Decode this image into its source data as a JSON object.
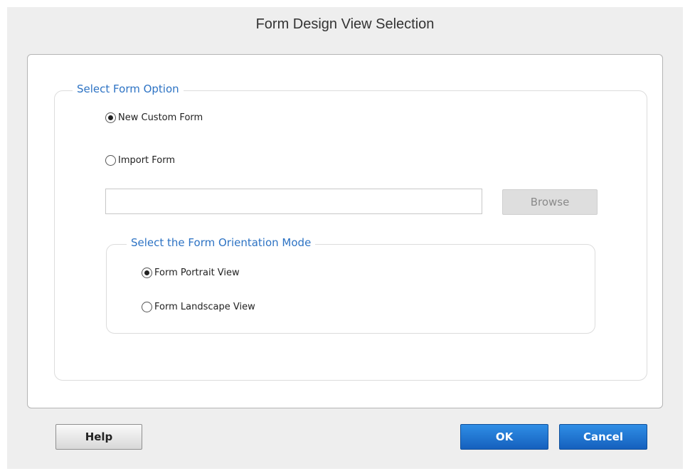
{
  "dialog": {
    "title": "Form Design View Selection"
  },
  "form_option": {
    "legend": "Select Form Option",
    "options": [
      {
        "label": "New Custom Form",
        "selected": true
      },
      {
        "label": "Import Form",
        "selected": false
      }
    ],
    "import_path": {
      "value": "",
      "placeholder": ""
    },
    "browse_label": "Browse"
  },
  "orientation": {
    "legend": "Select the Form Orientation Mode",
    "options": [
      {
        "label": "Form Portrait View",
        "selected": true
      },
      {
        "label": "Form Landscape View",
        "selected": false
      }
    ]
  },
  "buttons": {
    "help_label": "Help",
    "ok_label": "OK",
    "cancel_label": "Cancel"
  },
  "colors": {
    "legend_text": "#2d73c4",
    "primary_button": "#1f78d1",
    "disabled_button": "#dedede"
  }
}
